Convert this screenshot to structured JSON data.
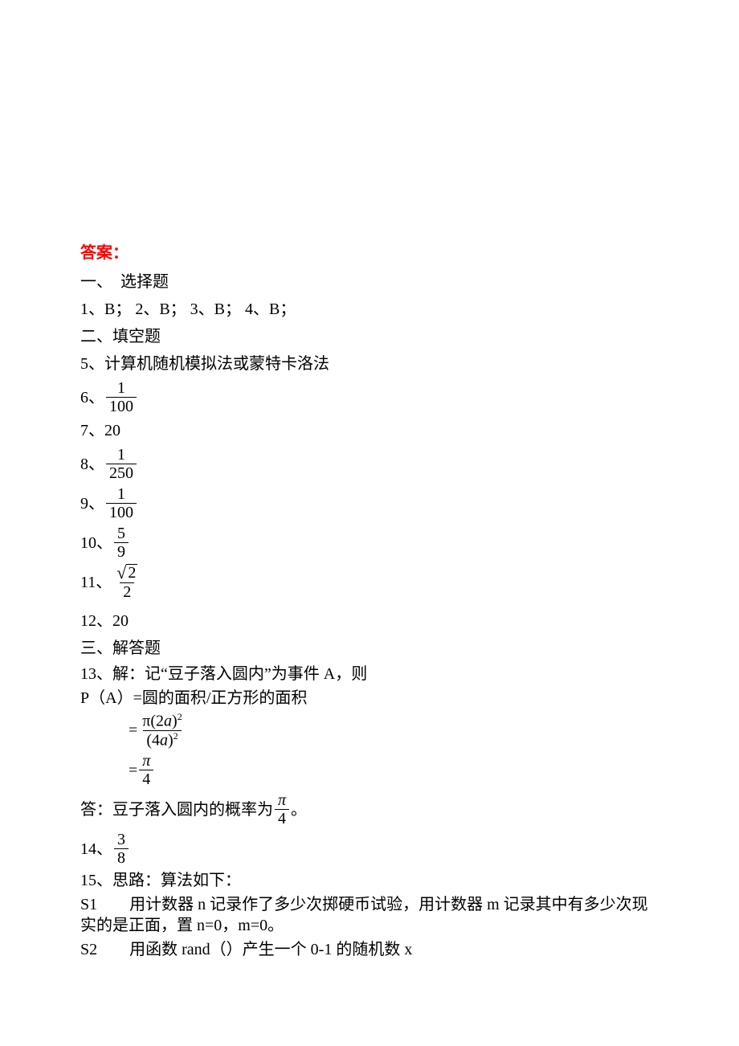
{
  "header": "答案：",
  "section1": {
    "title": "一、　选择题",
    "answers": "1、B；   2、B；   3、B；   4、B；"
  },
  "section2": {
    "title": "二、填空题",
    "a5": "5、计算机随机模拟法或蒙特卡洛法",
    "a6": {
      "prefix": "6、",
      "num": "1",
      "den": "100"
    },
    "a7": "7、20",
    "a8": {
      "prefix": "8、",
      "num": "1",
      "den": "250"
    },
    "a9": {
      "prefix": "9、",
      "num": "1",
      "den": "100"
    },
    "a10": {
      "prefix": "10、",
      "num": "5",
      "den": "9"
    },
    "a11": {
      "prefix": "11、",
      "rootval": "2",
      "den": "2"
    },
    "a12": "12、20"
  },
  "section3": {
    "title": "三、解答题",
    "a13_l1": "13、解：记“豆子落入圆内”为事件 A，则",
    "a13_l2": "P（A）=圆的面积/正方形的面积",
    "a13_eq1": {
      "eq": "=",
      "numL": "π(2",
      "numVar": "a",
      "numR": ")",
      "numExp": "2",
      "denL": "(4",
      "denVar": "a",
      "denR": ")",
      "denExp": "2"
    },
    "a13_eq2": {
      "eq": "=",
      "num": "π",
      "den": "4"
    },
    "a13_l3a": "答：豆子落入圆内的概率为",
    "a13_l3_num": "π",
    "a13_l3_den": "4",
    "a13_l3b": "。",
    "a14": {
      "prefix": "14、",
      "num": "3",
      "den": "8"
    },
    "a15_l1": "15、思路：算法如下：",
    "a15_l2": "S1　　用计数器 n 记录作了多少次掷硬币试验，用计数器 m 记录其中有多少次现实的是正面，置 n=0，m=0。",
    "a15_l3": "S2　　用函数 rand（）产生一个 0-1 的随机数 x"
  }
}
